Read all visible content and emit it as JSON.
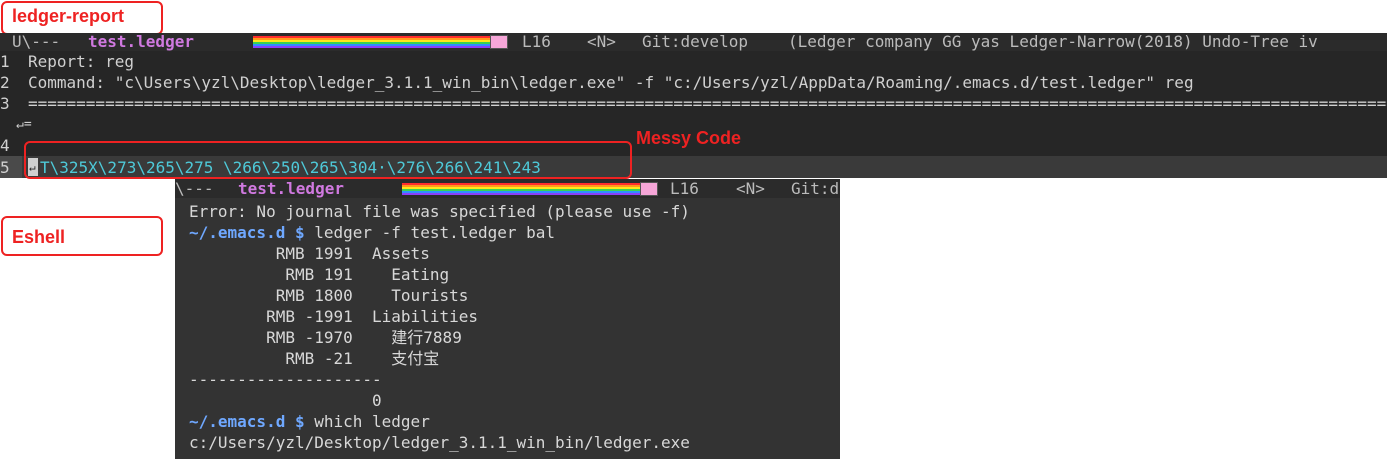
{
  "annotations": {
    "ledger_report_label": "ledger-report",
    "messy_code_label": "Messy Code",
    "eshell_label": "Eshell"
  },
  "top_window": {
    "modeline": {
      "state": "U\\---",
      "buffer_name": "test.ledger",
      "line": "L16",
      "mode_state": "<N>",
      "git": "Git:develop",
      "modes": "(Ledger company GG yas Ledger-Narrow(2018) Undo-Tree iv"
    },
    "lines": [
      {
        "num": "1",
        "text": "Report: reg"
      },
      {
        "num": "2",
        "text": "Command: \"c\\Users\\yzl\\Desktop\\ledger_3.1.1_win_bin\\ledger.exe\" -f \"c:/Users/yzl/AppData/Roaming/.emacs.d/test.ledger\" reg"
      },
      {
        "num": "3",
        "text": "==================================================================================================================================================================="
      },
      {
        "num": "",
        "text": "↵="
      },
      {
        "num": "4",
        "text": ""
      },
      {
        "num": "5",
        "text": "T\\325X\\273\\265\\275 \\266\\250\\265\\304·\\276\\266\\241\\243"
      }
    ],
    "line5_cursor_glyph": "↵"
  },
  "eshell": {
    "modeline": {
      "state": "\\---",
      "buffer_name": "test.ledger",
      "line": "L16",
      "mode_state": "<N>",
      "git": "Git:d"
    },
    "lines": [
      "Error: No journal file was specified (please use -f)",
      "",
      "         RMB 1991  Assets",
      "          RMB 191    Eating",
      "         RMB 1800    Tourists",
      "        RMB -1991  Liabilities",
      "        RMB -1970    建行7889",
      "          RMB -21    支付宝",
      "--------------------",
      "                   0",
      "",
      "c:/Users/yzl/Desktop/ledger_3.1.1_win_bin/ledger.exe"
    ],
    "prompt_1": "~/.emacs.d $",
    "command_1": " ledger -f test.ledger bal",
    "prompt_2": "~/.emacs.d $",
    "command_2": " which ledger"
  },
  "colors": {
    "buffer_bg": "#262626",
    "eshell_bg": "#333333",
    "buffer_name": "#d079e0",
    "messy_text": "#4ec9d8",
    "annotation": "#e22222",
    "prompt": "#6fa8ff"
  }
}
